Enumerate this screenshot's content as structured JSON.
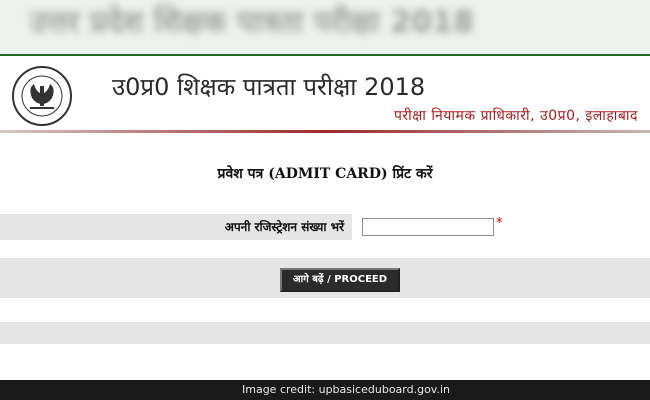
{
  "banner": {
    "blurred_text": "उत्तर प्रदेश शिक्षक पात्रता परीक्षा 2018"
  },
  "header": {
    "logo_icon": "up-government-emblem-icon",
    "title": "उ0प्र0 शिक्षक पात्रता परीक्षा 2018",
    "subtitle": "परीक्षा नियामक प्राधिकारी, उ0प्र0, इलाहाबाद"
  },
  "page": {
    "heading": "प्रवेश पत्र (ADMIT CARD) प्रिंट करें"
  },
  "form": {
    "registration_label": "अपनी रजिस्ट्रेशन संख्या भरें",
    "registration_value": "",
    "required_mark": "*"
  },
  "actions": {
    "proceed_label": "आगे बढ़ें / PROCEED"
  },
  "footer": {
    "credit": "Image credit: upbasiceduboard.gov.in"
  },
  "colors": {
    "title_text": "#2a2a2a",
    "subtitle_text": "#a61c1c",
    "banner_rule": "#1f6a24",
    "button_bg": "#2b2b2b",
    "required": "#cc0000"
  }
}
